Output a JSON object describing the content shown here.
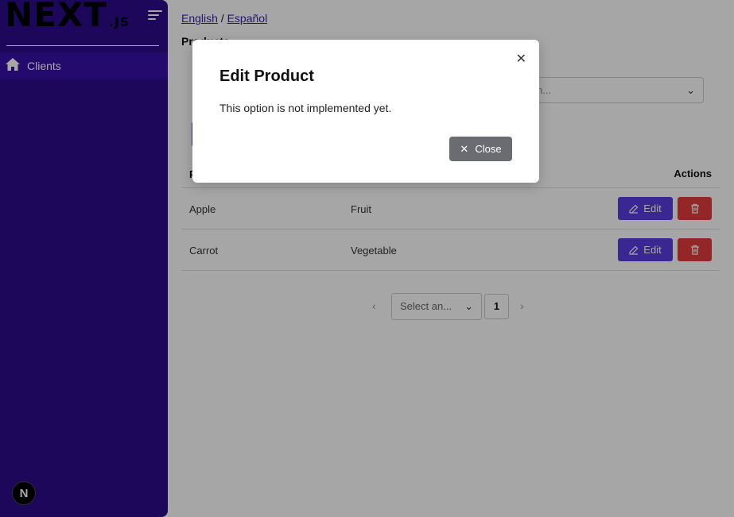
{
  "sidebar": {
    "logo_text": "NEXT",
    "logo_suffix": ".JS",
    "items": [
      {
        "label": "Clients"
      }
    ],
    "badge": "N"
  },
  "header": {
    "lang_en": "English",
    "lang_sep": " / ",
    "lang_es": "Español",
    "page_title": "Products"
  },
  "filter": {
    "placeholder": "n..."
  },
  "table": {
    "headers": {
      "name": "P",
      "actions": "Actions"
    },
    "rows": [
      {
        "name": "Apple",
        "category": "Fruit",
        "edit_label": "Edit"
      },
      {
        "name": "Carrot",
        "category": "Vegetable",
        "edit_label": "Edit"
      }
    ]
  },
  "pagination": {
    "select_placeholder": "Select an...",
    "page": "1"
  },
  "modal": {
    "title": "Edit Product",
    "body": "This option is not implemented yet.",
    "close_label": "Close"
  },
  "colors": {
    "sidebar": "#2b0b8c",
    "accent": "#5b3ce0",
    "danger": "#e23c3c",
    "close_btn": "#6b6b72"
  }
}
